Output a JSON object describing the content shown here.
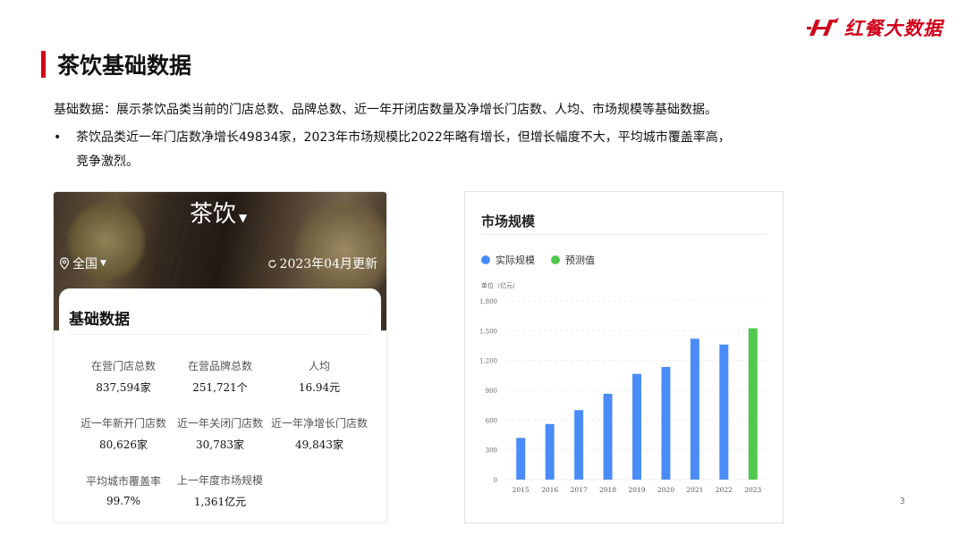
{
  "header": {
    "logo_text": "红餐大数据",
    "page_title": "茶饮基础数据",
    "brand_color": "#d0021b"
  },
  "intro": {
    "description": "基础数据：展示茶饮品类当前的门店总数、品牌总数、近一年开闭店数量及净增长门店数、人均、市场规模等基础数据。",
    "bullet_symbol": "•",
    "bullet_line1": "茶饮品类近一年门店数净增长49834家，2023年市场规模比2022年略有增长，但增长幅度不大，平均城市覆盖率高，",
    "bullet_line2": "竞争激烈。"
  },
  "app_card": {
    "category": "茶饮",
    "region": "全国",
    "update_text": "2023年04月更新",
    "section_title": "基础数据",
    "stats": [
      {
        "label": "在营门店总数",
        "value": "837,594家"
      },
      {
        "label": "在营品牌总数",
        "value": "251,721个"
      },
      {
        "label": "人均",
        "value": "16.94元"
      },
      {
        "label": "近一年新开门店数",
        "value": "80,626家"
      },
      {
        "label": "近一年关闭门店数",
        "value": "30,783家"
      },
      {
        "label": "近一年净增长门店数",
        "value": "49,843家"
      },
      {
        "label": "平均城市覆盖率",
        "value": "99.7%"
      },
      {
        "label": "上一年度市场规模",
        "value": "1,361亿元"
      }
    ]
  },
  "chart_card": {
    "title": "市场规模",
    "unit_label": "单位（亿元）"
  },
  "chart_data": {
    "type": "bar",
    "title": "市场规模",
    "ylabel": "单位（亿元）",
    "categories": [
      "2015",
      "2016",
      "2017",
      "2018",
      "2019",
      "2020",
      "2021",
      "2022",
      "2023"
    ],
    "ylim": [
      0,
      1800
    ],
    "yticks": [
      "0",
      "300",
      "600",
      "900",
      "1,200",
      "1,500",
      "1,800"
    ],
    "ytick_values": [
      0,
      300,
      600,
      900,
      1200,
      1500,
      1800
    ],
    "grid": true,
    "legend_position": "top-left",
    "series": [
      {
        "name": "实际规模",
        "color": "#4a8cf7",
        "values": [
          420,
          560,
          700,
          865,
          1065,
          1135,
          1420,
          1361,
          null
        ]
      },
      {
        "name": "预测值",
        "color": "#4ec94e",
        "values": [
          null,
          null,
          null,
          null,
          null,
          null,
          null,
          null,
          1525
        ]
      }
    ]
  },
  "footer": {
    "page_number": "3"
  }
}
